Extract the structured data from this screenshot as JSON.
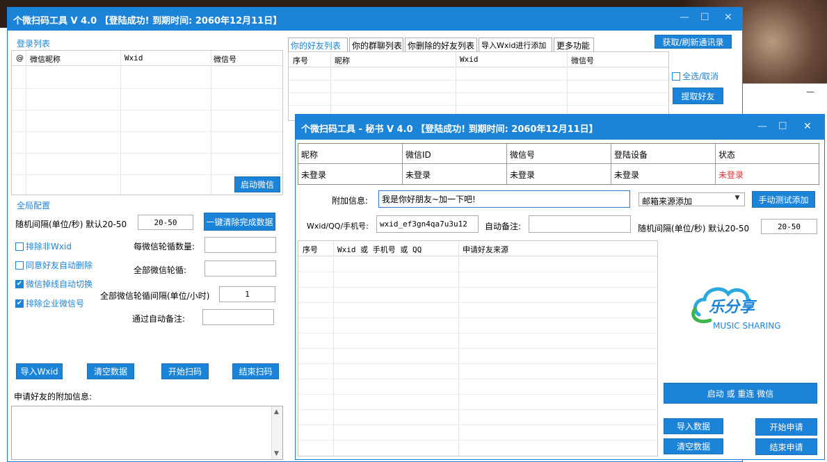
{
  "colors": {
    "accent": "#1c84d8",
    "warning": "#e03030"
  },
  "main_window": {
    "title": "个微扫码工具 V 4.0   【登陆成功! 到期时间: 2060年12月11日】",
    "minimize_glyph": "—",
    "maximize_glyph": "☐",
    "close_glyph": "✕",
    "login_list": {
      "label": "登录列表",
      "columns": [
        "@",
        "微信昵称",
        "Wxid",
        "微信号"
      ],
      "start_button": "启动微信"
    },
    "global_config": {
      "label": "全局配置",
      "interval_label": "随机间隔(单位/秒) 默认20-50",
      "interval_value": "20-50",
      "clear_done_button": "一键清除完成数据",
      "exclude_non_wxid": "排除非Wxid",
      "agree_auto_delete": "同意好友自动删除",
      "auto_switch": "微信掉线自动切换",
      "exclude_enterprise": "排除企业微信号",
      "per_wechat_rounds_label": "每微信轮循数量:",
      "all_wechat_rounds_label": "全部微信轮循:",
      "all_round_interval_label": "全部微信轮循间隔(单位/小时)",
      "all_round_interval_value": "1",
      "auto_remark_label": "通过自动备注:",
      "import_wxid": "导入Wxid",
      "clear_data": "清空数据",
      "start_scan": "开始扫码",
      "end_scan": "结束扫码",
      "attach_info_label": "申请好友的附加信息:"
    },
    "tabs": [
      "你的好友列表",
      "你的群聊列表",
      "你删除的好友列表",
      "导入Wxid进行添加",
      "更多功能"
    ],
    "refresh_button": "获取/刷新通讯录",
    "friend_columns": [
      "序号",
      "昵称",
      "Wxid",
      "微信号"
    ],
    "select_all": "全选/取消",
    "extract_button": "提取好友"
  },
  "secretary_window": {
    "title": "个微扫码工具 - 秘书 V 4.0   【登陆成功! 到期时间: 2060年12月11日】",
    "status_table": {
      "headers": [
        "昵称",
        "微信ID",
        "微信号",
        "登陆设备",
        "状态"
      ],
      "values": [
        "未登录",
        "未登录",
        "未登录",
        "未登录",
        "未登录"
      ]
    },
    "attach_label": "附加信息:",
    "attach_value": "我是你好朋友~加一下吧!",
    "source_select": "邮箱来源添加",
    "manual_test_button": "手动测试添加",
    "wxid_label": "Wxid/QQ/手机号:",
    "wxid_value": "wxid_ef3gn4qa7u3u12",
    "auto_remark_label": "自动备注:",
    "interval_label": "随机间隔(单位/秒) 默认20-50",
    "interval_value": "20-50",
    "list_columns": [
      "序号",
      "Wxid 或 手机号 或 QQ",
      "申请好友来源"
    ],
    "logo_cn": "乐分享",
    "logo_en": "MUSIC SHARING",
    "start_restart_button": "启动 或 重连 微信",
    "import_data": "导入数据",
    "start_apply": "开始申请",
    "clear_data": "清空数据",
    "end_apply": "结束申请"
  }
}
